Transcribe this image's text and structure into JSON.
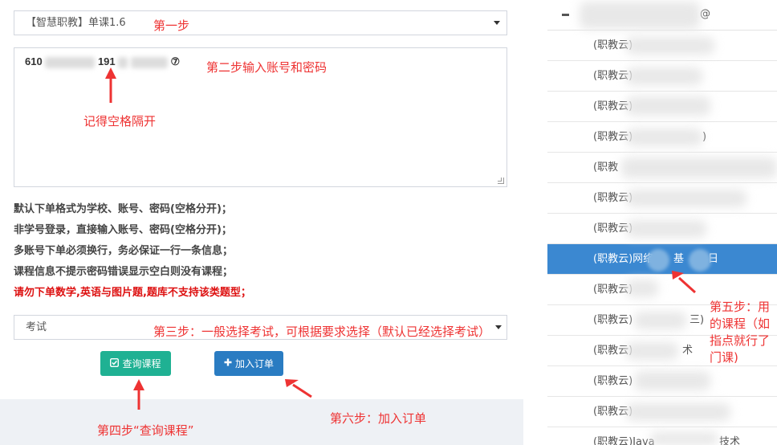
{
  "form": {
    "course_select_value": "【智慧职教】单课1.6",
    "account_prefix": "610",
    "account_mid": "191",
    "account_suffix": "⑦",
    "notes": [
      "默认下单格式为学校、账号、密码(空格分开)；",
      "非学号登录，直接输入账号、密码(空格分开)；",
      "多账号下单必须换行，务必保证一行一条信息；",
      "课程信息不提示密码错误显示空白则没有课程；"
    ],
    "warning": "请勿下单数学,英语与图片题,题库不支持该类题型；",
    "exam_select_value": "考试",
    "query_button_label": "查询课程",
    "add_button_label": "加入订单",
    "query_icon": "check-square-icon",
    "add_icon": "plus-icon"
  },
  "course_list": {
    "header_tail": "@",
    "items": [
      "(职教云)",
      "(职教云)",
      "(职教云)",
      "(职教云)",
      "(职教",
      "(职教云)",
      "(职教云)",
      "(职教云)网络",
      "(职教云)",
      "(职教云)",
      "(职教云)",
      "(职教云)",
      "(职教云)",
      "(职教云)Java"
    ],
    "active_index": 7,
    "item_extras": {
      "3": ")",
      "7": "基",
      "9": "三)",
      "10": "术",
      "13": "技术"
    }
  },
  "annotations": {
    "step1": "第一步",
    "step2": "第二步输入账号和密码",
    "space_hint": "记得空格隔开",
    "step3": "第三步：一般选择考试，可根据要求选择（默认已经选择考试）",
    "step4": "第四步“查询课程”",
    "step5_lines": [
      "第五步：用",
      "的课程（如",
      "指点就行了",
      "门课)"
    ],
    "step6": "第六步：加入订单"
  },
  "colors": {
    "annotation": "#ee3333",
    "query_button": "#1fb193",
    "add_button": "#2a7cc2",
    "active_item": "#3b88d1",
    "warning_text": "#dd1111"
  }
}
